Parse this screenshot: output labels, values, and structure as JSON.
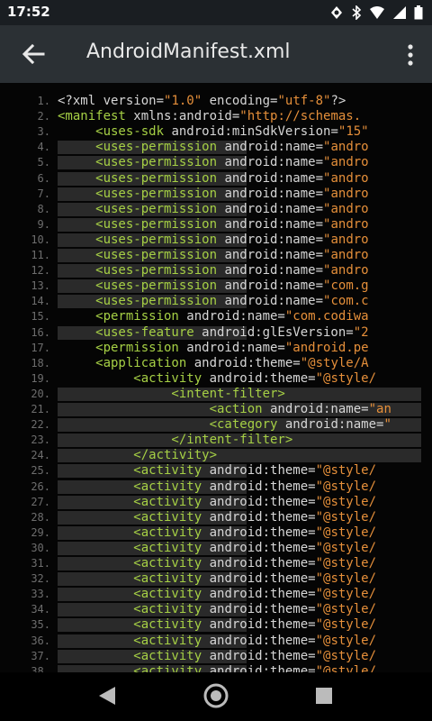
{
  "status_bar": {
    "time": "17:52",
    "icons": [
      "notification-icon",
      "bluetooth-icon",
      "wifi-icon",
      "signal-icon",
      "battery-icon"
    ]
  },
  "toolbar": {
    "back_icon": "arrow-left-icon",
    "title": "AndroidManifest.xml",
    "menu_icon": "more-vert-icon"
  },
  "editor": {
    "lines": [
      {
        "n": "1.",
        "tokens": [
          {
            "t": "<?xml version=",
            "c": "punct"
          },
          {
            "t": "\"1.0\"",
            "c": "val"
          },
          {
            "t": " encoding=",
            "c": "punct"
          },
          {
            "t": "\"utf-8\"",
            "c": "val"
          },
          {
            "t": "?>",
            "c": "punct"
          }
        ]
      },
      {
        "n": "2.",
        "tokens": [
          {
            "t": "<manifest",
            "c": "tag"
          },
          {
            "t": " xmlns:android=",
            "c": "attr"
          },
          {
            "t": "\"http://schemas.",
            "c": "val"
          }
        ]
      },
      {
        "n": "3.",
        "tokens": [
          {
            "t": "     <uses-sdk",
            "c": "tag"
          },
          {
            "t": " android:minSdkVersion=",
            "c": "attr"
          },
          {
            "t": "\"15\"",
            "c": "val"
          }
        ]
      },
      {
        "n": "4.",
        "tokens": [
          {
            "t": "     <uses-permission",
            "c": "tag"
          },
          {
            "t": " android:name=",
            "c": "attr"
          },
          {
            "t": "\"andro",
            "c": "val"
          }
        ]
      },
      {
        "n": "5.",
        "tokens": [
          {
            "t": "     <uses-permission",
            "c": "tag"
          },
          {
            "t": " android:name=",
            "c": "attr"
          },
          {
            "t": "\"andro",
            "c": "val"
          }
        ]
      },
      {
        "n": "6.",
        "tokens": [
          {
            "t": "     <uses-permission",
            "c": "tag"
          },
          {
            "t": " android:name=",
            "c": "attr"
          },
          {
            "t": "\"andro",
            "c": "val"
          }
        ]
      },
      {
        "n": "7.",
        "tokens": [
          {
            "t": "     <uses-permission",
            "c": "tag"
          },
          {
            "t": " android:name=",
            "c": "attr"
          },
          {
            "t": "\"andro",
            "c": "val"
          }
        ]
      },
      {
        "n": "8.",
        "tokens": [
          {
            "t": "     <uses-permission",
            "c": "tag"
          },
          {
            "t": " android:name=",
            "c": "attr"
          },
          {
            "t": "\"andro",
            "c": "val"
          }
        ]
      },
      {
        "n": "9.",
        "tokens": [
          {
            "t": "     <uses-permission",
            "c": "tag"
          },
          {
            "t": " android:name=",
            "c": "attr"
          },
          {
            "t": "\"andro",
            "c": "val"
          }
        ]
      },
      {
        "n": "10.",
        "tokens": [
          {
            "t": "     <uses-permission",
            "c": "tag"
          },
          {
            "t": " android:name=",
            "c": "attr"
          },
          {
            "t": "\"andro",
            "c": "val"
          }
        ]
      },
      {
        "n": "11.",
        "tokens": [
          {
            "t": "     <uses-permission",
            "c": "tag"
          },
          {
            "t": " android:name=",
            "c": "attr"
          },
          {
            "t": "\"andro",
            "c": "val"
          }
        ]
      },
      {
        "n": "12.",
        "tokens": [
          {
            "t": "     <uses-permission",
            "c": "tag"
          },
          {
            "t": " android:name=",
            "c": "attr"
          },
          {
            "t": "\"andro",
            "c": "val"
          }
        ]
      },
      {
        "n": "13.",
        "tokens": [
          {
            "t": "     <uses-permission",
            "c": "tag"
          },
          {
            "t": " android:name=",
            "c": "attr"
          },
          {
            "t": "\"com.g",
            "c": "val"
          }
        ]
      },
      {
        "n": "14.",
        "tokens": [
          {
            "t": "     <uses-permission",
            "c": "tag"
          },
          {
            "t": " android:name=",
            "c": "attr"
          },
          {
            "t": "\"com.c",
            "c": "val"
          }
        ]
      },
      {
        "n": "15.",
        "tokens": [
          {
            "t": "     <permission",
            "c": "tag"
          },
          {
            "t": " android:name=",
            "c": "attr"
          },
          {
            "t": "\"com.codiwa",
            "c": "val"
          }
        ]
      },
      {
        "n": "16.",
        "tokens": [
          {
            "t": "     <uses-feature",
            "c": "tag"
          },
          {
            "t": " android:glEsVersion=",
            "c": "attr"
          },
          {
            "t": "\"2",
            "c": "val"
          }
        ]
      },
      {
        "n": "17.",
        "tokens": [
          {
            "t": "     <permission",
            "c": "tag"
          },
          {
            "t": " android:name=",
            "c": "attr"
          },
          {
            "t": "\"android.pe",
            "c": "val"
          }
        ]
      },
      {
        "n": "18.",
        "tokens": [
          {
            "t": "     <application",
            "c": "tag"
          },
          {
            "t": " android:theme=",
            "c": "attr"
          },
          {
            "t": "\"@style/A",
            "c": "val"
          }
        ]
      },
      {
        "n": "19.",
        "tokens": [
          {
            "t": "          <activity",
            "c": "tag"
          },
          {
            "t": " android:theme=",
            "c": "attr"
          },
          {
            "t": "\"@style/",
            "c": "val"
          }
        ]
      },
      {
        "n": "20.",
        "tokens": [
          {
            "t": "               <intent-filter>",
            "c": "tag"
          }
        ]
      },
      {
        "n": "21.",
        "tokens": [
          {
            "t": "                    <action",
            "c": "tag"
          },
          {
            "t": " android:name=",
            "c": "attr"
          },
          {
            "t": "\"an",
            "c": "val"
          }
        ]
      },
      {
        "n": "22.",
        "tokens": [
          {
            "t": "                    <category",
            "c": "tag"
          },
          {
            "t": " android:name=",
            "c": "attr"
          },
          {
            "t": "\"",
            "c": "val"
          }
        ]
      },
      {
        "n": "23.",
        "tokens": [
          {
            "t": "               </intent-filter>",
            "c": "tag"
          }
        ]
      },
      {
        "n": "24.",
        "tokens": [
          {
            "t": "          </activity>",
            "c": "tag"
          }
        ]
      },
      {
        "n": "25.",
        "tokens": [
          {
            "t": "          <activity",
            "c": "tag"
          },
          {
            "t": " android:theme=",
            "c": "attr"
          },
          {
            "t": "\"@style/",
            "c": "val"
          }
        ]
      },
      {
        "n": "26.",
        "tokens": [
          {
            "t": "          <activity",
            "c": "tag"
          },
          {
            "t": " android:theme=",
            "c": "attr"
          },
          {
            "t": "\"@style/",
            "c": "val"
          }
        ]
      },
      {
        "n": "27.",
        "tokens": [
          {
            "t": "          <activity",
            "c": "tag"
          },
          {
            "t": " android:theme=",
            "c": "attr"
          },
          {
            "t": "\"@style/",
            "c": "val"
          }
        ]
      },
      {
        "n": "28.",
        "tokens": [
          {
            "t": "          <activity",
            "c": "tag"
          },
          {
            "t": " android:theme=",
            "c": "attr"
          },
          {
            "t": "\"@style/",
            "c": "val"
          }
        ]
      },
      {
        "n": "29.",
        "tokens": [
          {
            "t": "          <activity",
            "c": "tag"
          },
          {
            "t": " android:theme=",
            "c": "attr"
          },
          {
            "t": "\"@style/",
            "c": "val"
          }
        ]
      },
      {
        "n": "30.",
        "tokens": [
          {
            "t": "          <activity",
            "c": "tag"
          },
          {
            "t": " android:theme=",
            "c": "attr"
          },
          {
            "t": "\"@style/",
            "c": "val"
          }
        ]
      },
      {
        "n": "31.",
        "tokens": [
          {
            "t": "          <activity",
            "c": "tag"
          },
          {
            "t": " android:theme=",
            "c": "attr"
          },
          {
            "t": "\"@style/",
            "c": "val"
          }
        ]
      },
      {
        "n": "32.",
        "tokens": [
          {
            "t": "          <activity",
            "c": "tag"
          },
          {
            "t": " android:theme=",
            "c": "attr"
          },
          {
            "t": "\"@style/",
            "c": "val"
          }
        ]
      },
      {
        "n": "33.",
        "tokens": [
          {
            "t": "          <activity",
            "c": "tag"
          },
          {
            "t": " android:theme=",
            "c": "attr"
          },
          {
            "t": "\"@style/",
            "c": "val"
          }
        ]
      },
      {
        "n": "34.",
        "tokens": [
          {
            "t": "          <activity",
            "c": "tag"
          },
          {
            "t": " android:theme=",
            "c": "attr"
          },
          {
            "t": "\"@style/",
            "c": "val"
          }
        ]
      },
      {
        "n": "35.",
        "tokens": [
          {
            "t": "          <activity",
            "c": "tag"
          },
          {
            "t": " android:theme=",
            "c": "attr"
          },
          {
            "t": "\"@style/",
            "c": "val"
          }
        ]
      },
      {
        "n": "36.",
        "tokens": [
          {
            "t": "          <activity",
            "c": "tag"
          },
          {
            "t": " android:theme=",
            "c": "attr"
          },
          {
            "t": "\"@style/",
            "c": "val"
          }
        ]
      },
      {
        "n": "37.",
        "tokens": [
          {
            "t": "          <activity",
            "c": "tag"
          },
          {
            "t": " android:theme=",
            "c": "attr"
          },
          {
            "t": "\"@style/",
            "c": "val"
          }
        ]
      },
      {
        "n": "38.",
        "tokens": [
          {
            "t": "          <activity",
            "c": "tag"
          },
          {
            "t": " android:theme=",
            "c": "attr"
          },
          {
            "t": "\"@style/",
            "c": "val"
          }
        ]
      }
    ]
  },
  "nav_bar": {
    "back_icon": "triangle-back-icon",
    "home_icon": "circle-home-icon",
    "recents_icon": "square-recents-icon"
  },
  "colors": {
    "tag": "#a6d045",
    "value": "#e58f3a",
    "attribute": "#d6d6d6",
    "line_number": "#6d6d6d",
    "toolbar": "#2b3034",
    "status_bar": "#1a1e22"
  }
}
